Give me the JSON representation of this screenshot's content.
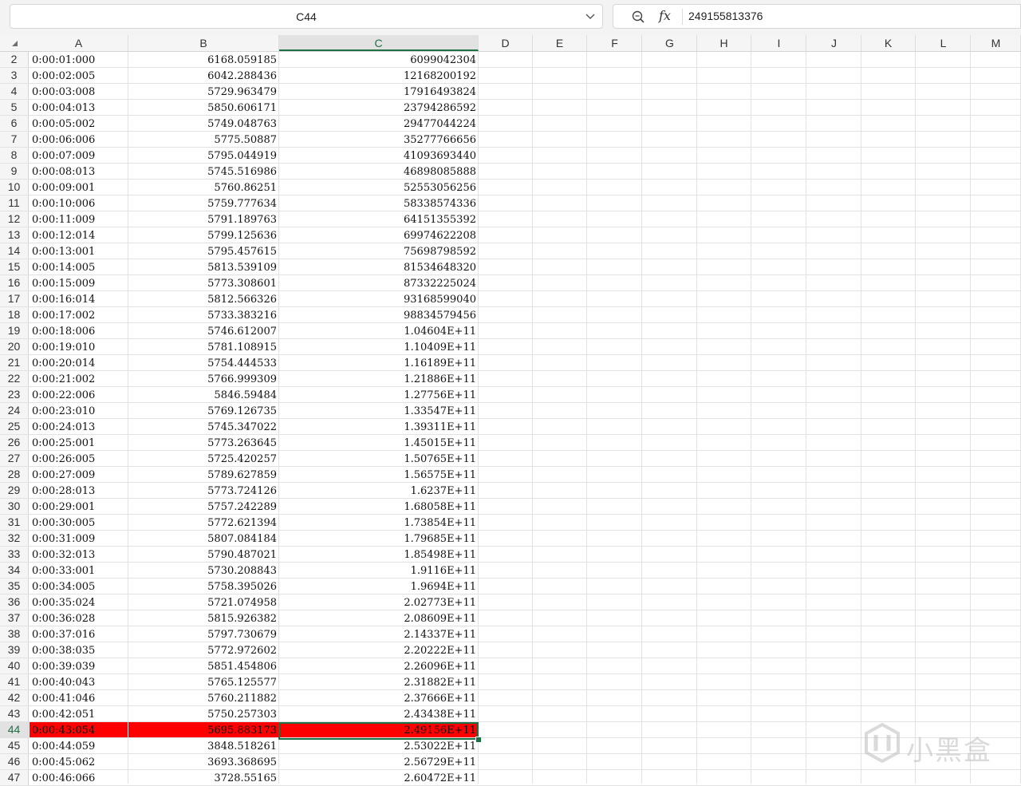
{
  "formula_bar": {
    "name_box": "C44",
    "formula_value": "249155813376"
  },
  "columns": [
    "A",
    "B",
    "C",
    "D",
    "E",
    "F",
    "G",
    "H",
    "I",
    "J",
    "K",
    "L",
    "M"
  ],
  "selected_column": "C",
  "selected_row": "44",
  "rows": [
    {
      "n": "2",
      "a": "0:00:01:000",
      "b": "6168.059185",
      "c": "6099042304"
    },
    {
      "n": "3",
      "a": "0:00:02:005",
      "b": "6042.288436",
      "c": "12168200192"
    },
    {
      "n": "4",
      "a": "0:00:03:008",
      "b": "5729.963479",
      "c": "17916493824"
    },
    {
      "n": "5",
      "a": "0:00:04:013",
      "b": "5850.606171",
      "c": "23794286592"
    },
    {
      "n": "6",
      "a": "0:00:05:002",
      "b": "5749.048763",
      "c": "29477044224"
    },
    {
      "n": "7",
      "a": "0:00:06:006",
      "b": "5775.50887",
      "c": "35277766656"
    },
    {
      "n": "8",
      "a": "0:00:07:009",
      "b": "5795.044919",
      "c": "41093693440"
    },
    {
      "n": "9",
      "a": "0:00:08:013",
      "b": "5745.516986",
      "c": "46898085888"
    },
    {
      "n": "10",
      "a": "0:00:09:001",
      "b": "5760.86251",
      "c": "52553056256"
    },
    {
      "n": "11",
      "a": "0:00:10:006",
      "b": "5759.777634",
      "c": "58338574336"
    },
    {
      "n": "12",
      "a": "0:00:11:009",
      "b": "5791.189763",
      "c": "64151355392"
    },
    {
      "n": "13",
      "a": "0:00:12:014",
      "b": "5799.125636",
      "c": "69974622208"
    },
    {
      "n": "14",
      "a": "0:00:13:001",
      "b": "5795.457615",
      "c": "75698798592"
    },
    {
      "n": "15",
      "a": "0:00:14:005",
      "b": "5813.539109",
      "c": "81534648320"
    },
    {
      "n": "16",
      "a": "0:00:15:009",
      "b": "5773.308601",
      "c": "87332225024"
    },
    {
      "n": "17",
      "a": "0:00:16:014",
      "b": "5812.566326",
      "c": "93168599040"
    },
    {
      "n": "18",
      "a": "0:00:17:002",
      "b": "5733.383216",
      "c": "98834579456"
    },
    {
      "n": "19",
      "a": "0:00:18:006",
      "b": "5746.612007",
      "c": "1.04604E+11"
    },
    {
      "n": "20",
      "a": "0:00:19:010",
      "b": "5781.108915",
      "c": "1.10409E+11"
    },
    {
      "n": "21",
      "a": "0:00:20:014",
      "b": "5754.444533",
      "c": "1.16189E+11"
    },
    {
      "n": "22",
      "a": "0:00:21:002",
      "b": "5766.999309",
      "c": "1.21886E+11"
    },
    {
      "n": "23",
      "a": "0:00:22:006",
      "b": "5846.59484",
      "c": "1.27756E+11"
    },
    {
      "n": "24",
      "a": "0:00:23:010",
      "b": "5769.126735",
      "c": "1.33547E+11"
    },
    {
      "n": "25",
      "a": "0:00:24:013",
      "b": "5745.347022",
      "c": "1.39311E+11"
    },
    {
      "n": "26",
      "a": "0:00:25:001",
      "b": "5773.263645",
      "c": "1.45015E+11"
    },
    {
      "n": "27",
      "a": "0:00:26:005",
      "b": "5725.420257",
      "c": "1.50765E+11"
    },
    {
      "n": "28",
      "a": "0:00:27:009",
      "b": "5789.627859",
      "c": "1.56575E+11"
    },
    {
      "n": "29",
      "a": "0:00:28:013",
      "b": "5773.724126",
      "c": "1.6237E+11"
    },
    {
      "n": "30",
      "a": "0:00:29:001",
      "b": "5757.242289",
      "c": "1.68058E+11"
    },
    {
      "n": "31",
      "a": "0:00:30:005",
      "b": "5772.621394",
      "c": "1.73854E+11"
    },
    {
      "n": "32",
      "a": "0:00:31:009",
      "b": "5807.084184",
      "c": "1.79685E+11"
    },
    {
      "n": "33",
      "a": "0:00:32:013",
      "b": "5790.487021",
      "c": "1.85498E+11"
    },
    {
      "n": "34",
      "a": "0:00:33:001",
      "b": "5730.208843",
      "c": "1.9116E+11"
    },
    {
      "n": "35",
      "a": "0:00:34:005",
      "b": "5758.395026",
      "c": "1.9694E+11"
    },
    {
      "n": "36",
      "a": "0:00:35:024",
      "b": "5721.074958",
      "c": "2.02773E+11"
    },
    {
      "n": "37",
      "a": "0:00:36:028",
      "b": "5815.926382",
      "c": "2.08609E+11"
    },
    {
      "n": "38",
      "a": "0:00:37:016",
      "b": "5797.730679",
      "c": "2.14337E+11"
    },
    {
      "n": "39",
      "a": "0:00:38:035",
      "b": "5772.972602",
      "c": "2.20222E+11"
    },
    {
      "n": "40",
      "a": "0:00:39:039",
      "b": "5851.454806",
      "c": "2.26096E+11"
    },
    {
      "n": "41",
      "a": "0:00:40:043",
      "b": "5765.125577",
      "c": "2.31882E+11"
    },
    {
      "n": "42",
      "a": "0:00:41:046",
      "b": "5760.211882",
      "c": "2.37666E+11"
    },
    {
      "n": "43",
      "a": "0:00:42:051",
      "b": "5750.257303",
      "c": "2.43438E+11"
    },
    {
      "n": "44",
      "a": "0:00:43:054",
      "b": "5695.883173",
      "c": "2.49156E+11",
      "highlight": "#ff0000"
    },
    {
      "n": "45",
      "a": "0:00:44:059",
      "b": "3848.518261",
      "c": "2.53022E+11"
    },
    {
      "n": "46",
      "a": "0:00:45:062",
      "b": "3693.368695",
      "c": "2.56729E+11"
    },
    {
      "n": "47",
      "a": "0:00:46:066",
      "b": "3728.55165",
      "c": "2.60472E+11"
    }
  ],
  "watermark": {
    "text": "小黑盒",
    "icon": "heybox-logo-icon"
  },
  "colors": {
    "selection_accent": "#1e7145",
    "highlight_fill": "#ff0000"
  }
}
